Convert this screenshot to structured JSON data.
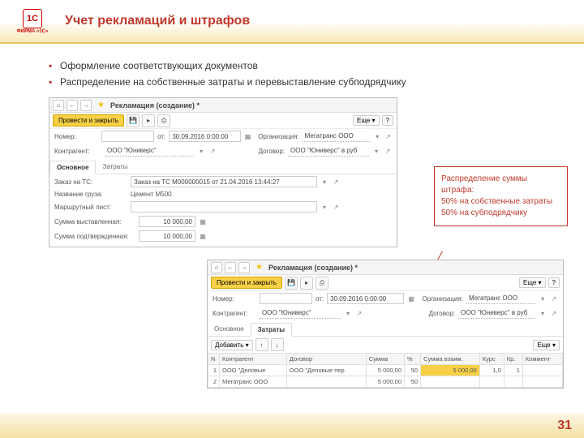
{
  "header": {
    "logo_text": "ФИРМА «1С»",
    "logo_badge": "1C",
    "title": "Учет рекламаций и штрафов"
  },
  "bullets": [
    "Оформление соответствующих документов",
    "Распределение на собственные затраты и перевыставление субподрядчику"
  ],
  "win": {
    "title": "Рекламация (создание) *",
    "post_close": "Провести и закрыть",
    "more": "Еще",
    "help": "?",
    "номер_lbl": "Номер:",
    "от_lbl": "от:",
    "от_val": "30.09.2016  0:00:00",
    "орг_lbl": "Организация:",
    "орг_val": "Мегатранс ООО",
    "контр_lbl": "Контрагент:",
    "контр_val": "ООО \"Юниверс\"",
    "дог_lbl": "Договор:",
    "дог_val": "ООО \"Юниверс\" в руб",
    "tab_main": "Основное",
    "tab_cost": "Затраты",
    "заказ_lbl": "Заказ на ТС:",
    "заказ_val": "Заказ на ТС М000000015 от 21.04.2016 13:44:27",
    "груз_lbl": "Название груза:",
    "груз_val": "Цемент М500",
    "маршрут_lbl": "Маршрутный лист:",
    "выст_lbl": "Сумма выставленная:",
    "выст_val": "10 000,00",
    "подтв_lbl": "Сумма подтвержденная:",
    "подтв_val": "10 000,00"
  },
  "callout": {
    "l1": "Распределение суммы штрафа:",
    "l2": "50% на собственные затраты",
    "l3": "50% на субподрядчику"
  },
  "win2": {
    "add": "Добавить",
    "cols": {
      "n": "N",
      "контр": "Контрагент",
      "дог": "Договор",
      "сумма": "Сумма",
      "pct": "%",
      "взаим": "Сумма взаим.",
      "курс": "Курс",
      "кр": "Кр.",
      "ком": "Коммент"
    },
    "rows": [
      {
        "n": "1",
        "контр": "ООО \"Деловые",
        "дог": "ООО \"Деловые пер",
        "сумма": "5 000,00",
        "pct": "50",
        "взаим": "5 000,00",
        "курс": "1,0",
        "кр": "1",
        "ком": ""
      },
      {
        "n": "2",
        "контр": "Мегатранс ООО",
        "дог": "",
        "сумма": "5 000,00",
        "pct": "50",
        "взаим": "",
        "курс": "",
        "кр": "",
        "ком": ""
      }
    ]
  },
  "page": "31"
}
